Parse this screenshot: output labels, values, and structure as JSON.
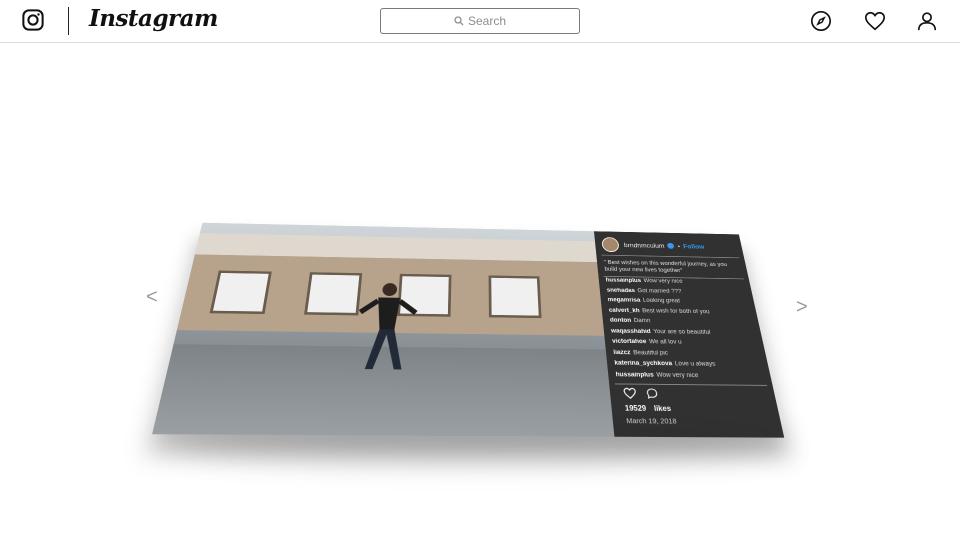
{
  "header": {
    "wordmark": "Instagram",
    "search_placeholder": "Search"
  },
  "nav": {
    "prev_arrow": "<",
    "next_arrow": ">"
  },
  "post": {
    "username": "brndnmculum",
    "follow_label": "Follow",
    "caption": "\" Best wishes on this wonderful journey, as you build your new lives together\"",
    "comments": [
      {
        "user": "hussainplus",
        "text": "Wow very nice"
      },
      {
        "user": "snehadas",
        "text": "Got married ???"
      },
      {
        "user": "megamrisa",
        "text": "Looking great"
      },
      {
        "user": "calvert_kh",
        "text": "Best wish for both of you"
      },
      {
        "user": "donton",
        "text": "Damn"
      },
      {
        "user": "waqasshahid",
        "text": "Your are so beautiful"
      },
      {
        "user": "victortahoe",
        "text": "We all lov u"
      },
      {
        "user": "liazcz",
        "text": "Beautiful pic"
      },
      {
        "user": "katerina_sychkova",
        "text": "Love u always"
      },
      {
        "user": "hussainplus",
        "text": "Wow very nice"
      }
    ],
    "likes_count": "19529",
    "likes_label": "likes",
    "date": "March 19, 2018"
  },
  "colors": {
    "accent": "#3897f0",
    "panel": "#202020",
    "border": "#dbdbdb"
  }
}
